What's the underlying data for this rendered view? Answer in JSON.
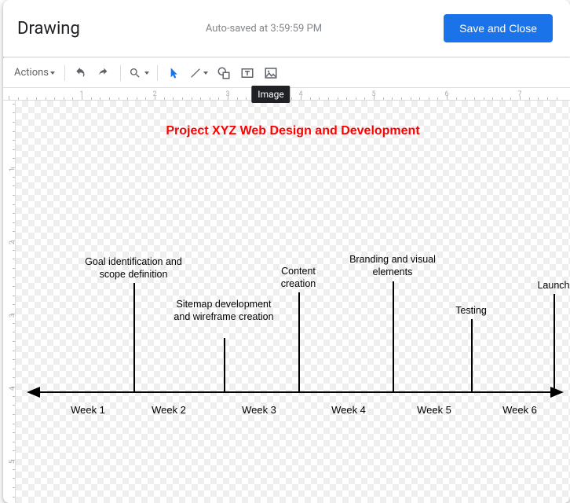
{
  "header": {
    "title": "Drawing",
    "status": "Auto-saved at 3:59:59 PM",
    "save_label": "Save and Close"
  },
  "toolbar": {
    "actions_label": "Actions",
    "tooltip_image": "Image"
  },
  "drawing": {
    "title": "Project XYZ Web Design and Development",
    "weeks": [
      "Week 1",
      "Week 2",
      "Week 3",
      "Week 4",
      "Week 5",
      "Week 6"
    ],
    "milestones": [
      {
        "label": "Goal identification and scope definition"
      },
      {
        "label": "Sitemap development and wireframe creation"
      },
      {
        "label": "Content creation"
      },
      {
        "label": "Branding and visual elements"
      },
      {
        "label": "Testing"
      },
      {
        "label": "Launch"
      }
    ]
  },
  "ruler": {
    "h": [
      1,
      2,
      3,
      4,
      5,
      6,
      7
    ],
    "v": [
      1,
      2,
      3,
      4,
      5
    ]
  }
}
